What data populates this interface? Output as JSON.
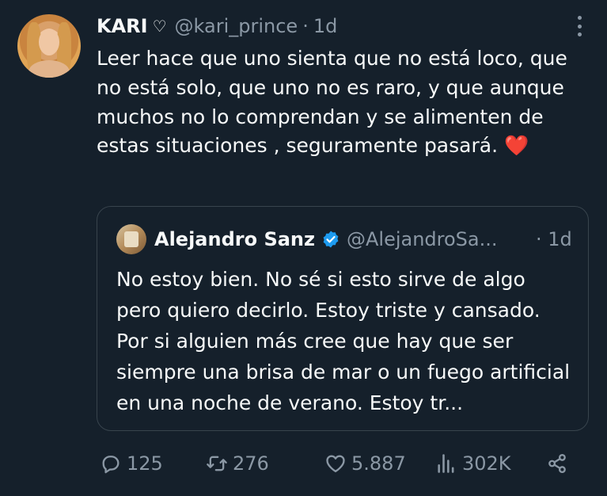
{
  "tweet": {
    "author_name": "KARI",
    "author_name_symbol": "♡",
    "handle": "@kari_prince",
    "separator": "·",
    "time": "1d",
    "text": "Leer hace que uno sienta que no está loco, que no está solo, que uno no es raro, y que aunque muchos no lo comprendan y se alimenten de estas situaciones , seguramente pasará.",
    "emoji": "❤️"
  },
  "quoted_tweet": {
    "author_name": "Alejandro Sanz",
    "handle": "@AlejandroSa...",
    "separator": "·",
    "time": "1d",
    "text": "No estoy bien. No sé si esto sirve de algo pero quiero decirlo. Estoy triste y cansado. Por si alguien más cree que hay que ser siempre una brisa de mar o un fuego artificial en una noche de verano. Estoy tr..."
  },
  "actions": {
    "replies": "125",
    "retweets": "276",
    "likes": "5.887",
    "views": "302K"
  },
  "icons": [
    "more-icon",
    "verified-badge-icon",
    "reply-icon",
    "retweet-icon",
    "like-icon",
    "views-icon",
    "share-icon"
  ],
  "colors": {
    "background": "#15202b",
    "text": "#f7f9f9",
    "muted": "#8b98a5",
    "verified": "#1d9bf0",
    "border": "#38444d",
    "heart": "#f4212e"
  }
}
